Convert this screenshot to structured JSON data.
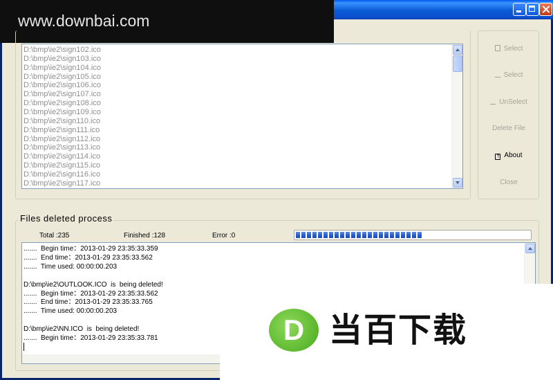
{
  "watermark": {
    "site": "www.downbai.com",
    "logo_letter": "D",
    "logo_text": "当百下载"
  },
  "icons": {
    "select_all": "document-icon",
    "select": "underline-icon",
    "unselect": "folder-icon",
    "about": "help-icon"
  },
  "file_list": {
    "items": [
      "D:\\bmp\\ie2\\sign102.ico",
      "D:\\bmp\\ie2\\sign103.ico",
      "D:\\bmp\\ie2\\sign104.ico",
      "D:\\bmp\\ie2\\sign105.ico",
      "D:\\bmp\\ie2\\sign106.ico",
      "D:\\bmp\\ie2\\sign107.ico",
      "D:\\bmp\\ie2\\sign108.ico",
      "D:\\bmp\\ie2\\sign109.ico",
      "D:\\bmp\\ie2\\sign110.ico",
      "D:\\bmp\\ie2\\sign111.ico",
      "D:\\bmp\\ie2\\sign112.ico",
      "D:\\bmp\\ie2\\sign113.ico",
      "D:\\bmp\\ie2\\sign114.ico",
      "D:\\bmp\\ie2\\sign115.ico",
      "D:\\bmp\\ie2\\sign116.ico",
      "D:\\bmp\\ie2\\sign117.ico"
    ]
  },
  "buttons": {
    "select_all": "Select",
    "select": "Select",
    "unselect": "UnSelect",
    "delete_file": "Delete File",
    "about": "About",
    "close": "Close"
  },
  "process": {
    "legend": "Files  deleted  process",
    "total": "Total :235",
    "finished": "Finished :128",
    "error": "Error :0",
    "progress_fraction": 0.54
  },
  "log": {
    "lines": [
      ".......  Begin time：2013-01-29 23:35:33.359",
      ".......  End time：2013-01-29 23:35:33.562",
      ".......  Time used: 00:00:00.203",
      "",
      "D:\\bmp\\ie2\\OUTLOOK.ICO  is  being deleted!",
      ".......  Begin time：2013-01-29 23:35:33.562",
      ".......  End time：2013-01-29 23:35:33.765",
      ".......  Time used: 00:00:00.203",
      "",
      "D:\\bmp\\ie2\\NN.ICO  is  being deleted!",
      ".......  Begin time：2013-01-29 23:35:33.781"
    ]
  }
}
